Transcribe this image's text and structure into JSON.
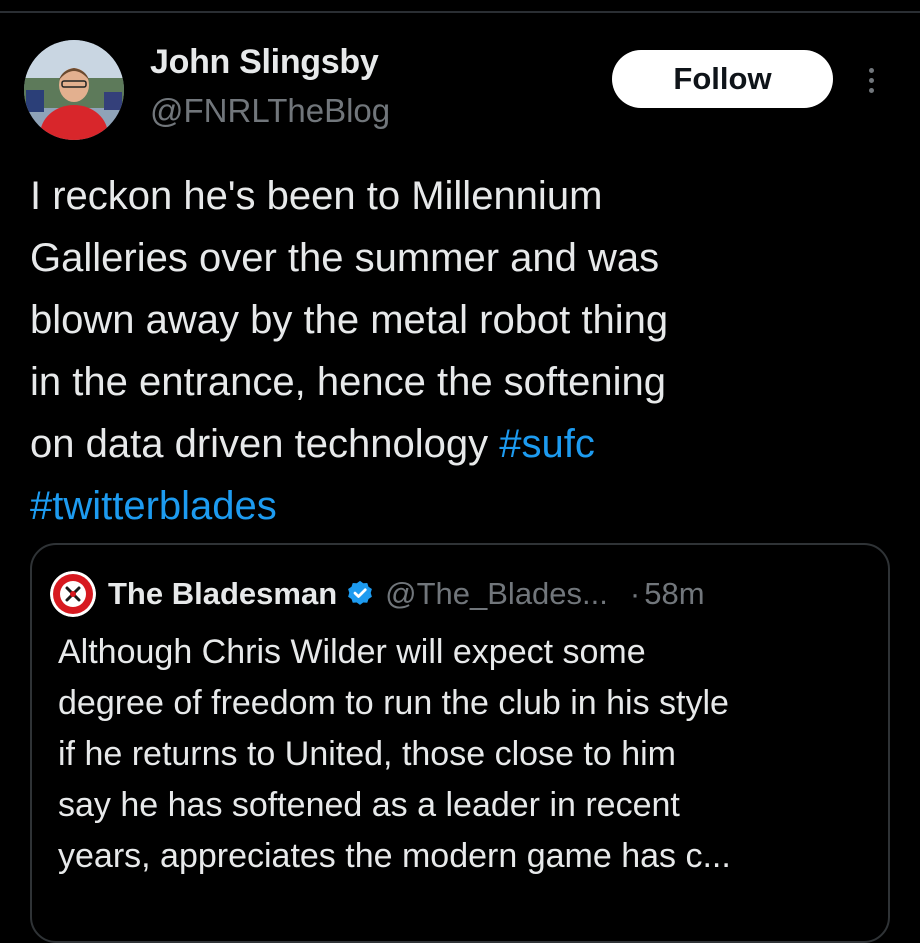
{
  "colors": {
    "background": "#000000",
    "text": "#e7e9ea",
    "secondary_text": "#71767b",
    "hashtag": "#1d9bf0",
    "follow_button_bg": "#ffffff",
    "card_border": "#2f3336"
  },
  "tweet": {
    "author": {
      "display_name": "John Slingsby",
      "handle": "@FNRLTheBlog",
      "avatar_icon": "user-avatar-photo"
    },
    "follow_label": "Follow",
    "more_icon": "more-vertical-icon",
    "text_lines": [
      [
        "I reckon he's been to Millennium"
      ],
      [
        "Galleries over the summer and was"
      ],
      [
        "blown away by the metal robot thing"
      ],
      [
        "in the entrance, hence the softening"
      ],
      [
        "on data driven technology ",
        "#sufc"
      ],
      [
        "#twitterblades"
      ]
    ]
  },
  "quote": {
    "author": {
      "display_name": "The Bladesman",
      "handle": "@The_Blades...",
      "avatar_icon": "club-crest-avatar",
      "verified_icon": "verified-badge-icon"
    },
    "separator": "·",
    "time": "58m",
    "text_lines": [
      "Although Chris Wilder will expect some",
      "degree of freedom to run the club in his style",
      "if he returns to United, those close to him",
      "say he has softened as a leader in recent",
      "years, appreciates the modern game has c..."
    ]
  }
}
